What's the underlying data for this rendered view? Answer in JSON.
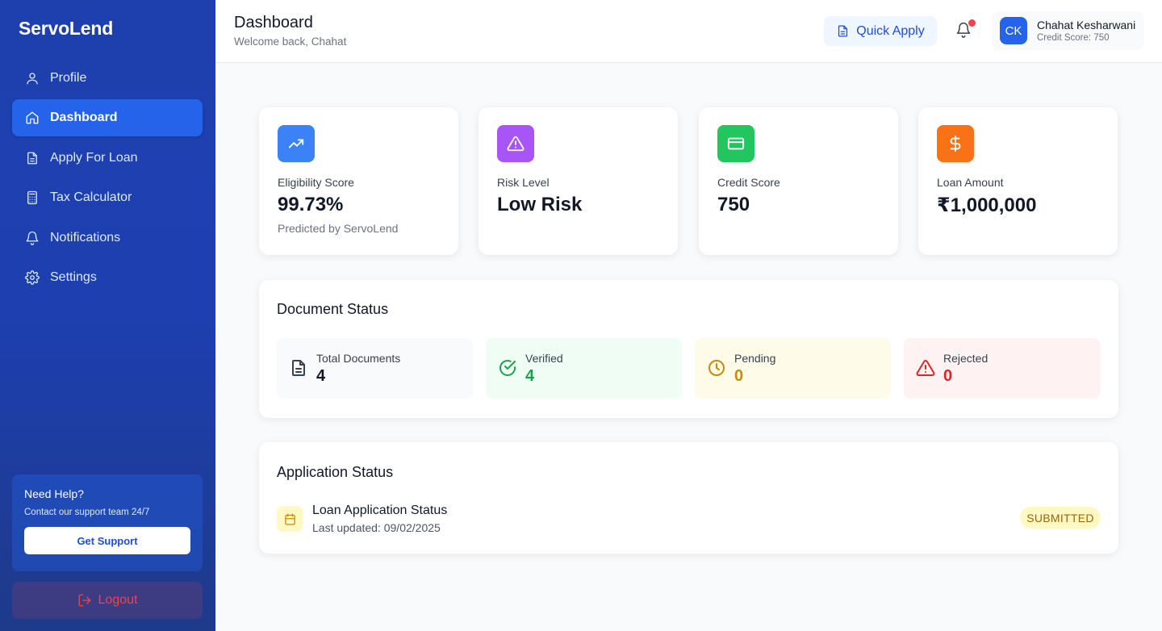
{
  "brand": "ServoLend",
  "sidebar": {
    "items": [
      {
        "label": "Profile",
        "icon": "user-icon",
        "active": false
      },
      {
        "label": "Dashboard",
        "icon": "home-icon",
        "active": true
      },
      {
        "label": "Apply For Loan",
        "icon": "document-icon",
        "active": false
      },
      {
        "label": "Tax Calculator",
        "icon": "calculator-icon",
        "active": false
      },
      {
        "label": "Notifications",
        "icon": "bell-icon",
        "active": false
      },
      {
        "label": "Settings",
        "icon": "gear-icon",
        "active": false
      }
    ],
    "help": {
      "title": "Need Help?",
      "subtitle": "Contact our support team 24/7",
      "button": "Get Support"
    },
    "logout": "Logout"
  },
  "header": {
    "title": "Dashboard",
    "welcome": "Welcome back, Chahat",
    "quick_apply": "Quick Apply",
    "notification_unread": true,
    "user": {
      "initials": "CK",
      "name": "Chahat Kesharwani",
      "credit_line": "Credit Score: 750"
    }
  },
  "stats": [
    {
      "label": "Eligibility Score",
      "value": "99.73%",
      "sub": "Predicted by ServoLend",
      "icon": "trending-up-icon",
      "color": "#3b82f6"
    },
    {
      "label": "Risk Level",
      "value": "Low Risk",
      "sub": "",
      "icon": "warning-triangle-icon",
      "color": "#a855f7"
    },
    {
      "label": "Credit Score",
      "value": "750",
      "sub": "",
      "icon": "credit-card-icon",
      "color": "#22c55e"
    },
    {
      "label": "Loan Amount",
      "value": "₹1,000,000",
      "sub": "",
      "icon": "dollar-icon",
      "color": "#f97316"
    }
  ],
  "documents": {
    "title": "Document Status",
    "items": [
      {
        "label": "Total Documents",
        "count": "4",
        "icon": "file-icon",
        "color": "#111827",
        "bg": "#f9fafb"
      },
      {
        "label": "Verified",
        "count": "4",
        "icon": "check-circle-icon",
        "color": "#16a34a",
        "bg": "#f0fdf4"
      },
      {
        "label": "Pending",
        "count": "0",
        "icon": "clock-icon",
        "color": "#ca8a04",
        "bg": "#fefce8"
      },
      {
        "label": "Rejected",
        "count": "0",
        "icon": "warning-triangle-icon",
        "color": "#dc2626",
        "bg": "#fef2f2"
      }
    ]
  },
  "application": {
    "title": "Application Status",
    "name": "Loan Application Status",
    "updated": "Last updated: 09/02/2025",
    "status": "SUBMITTED"
  }
}
